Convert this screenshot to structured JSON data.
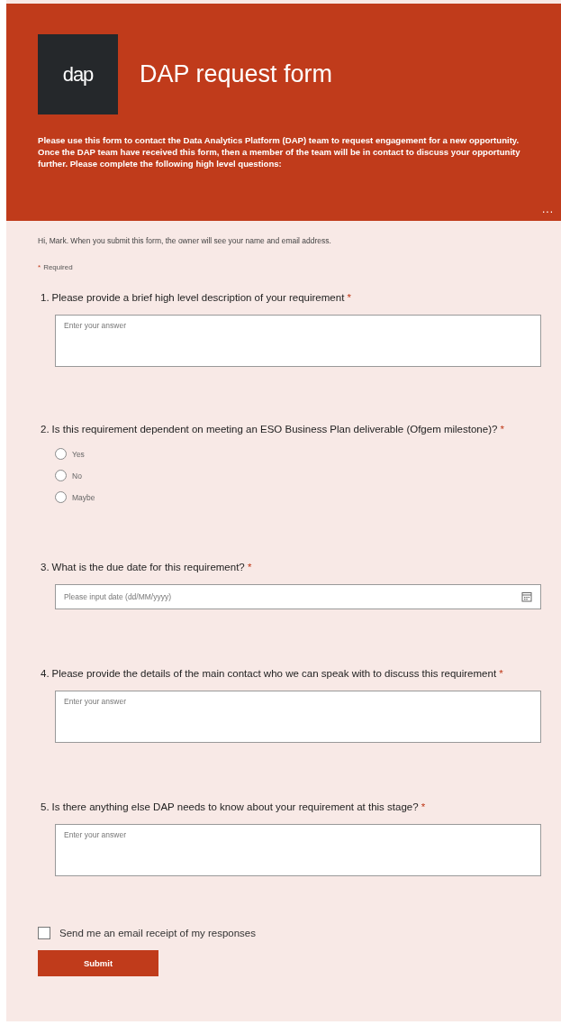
{
  "header": {
    "logo_text": "dap",
    "title": "DAP request form",
    "description": "Please use this form to contact the Data Analytics Platform (DAP) team to request engagement for a new opportunity. Once the DAP team have received this form, then a member of the team will be in contact to discuss your opportunity further. Please complete the following high level questions:",
    "more": "..."
  },
  "notice": "Hi, Mark. When you submit this form, the owner will see your name and email address.",
  "required_legend": {
    "mark": "*",
    "label": "Required"
  },
  "questions": [
    {
      "kind": "text",
      "number": "1.",
      "text": "Please provide a brief high level description of your requirement",
      "mark": "*",
      "placeholder": "Enter your answer"
    },
    {
      "kind": "choice",
      "number": "2.",
      "text": "Is this requirement dependent on meeting an ESO Business Plan deliverable (Ofgem milestone)?",
      "mark": "*",
      "options": [
        {
          "label": "Yes",
          "selected": false
        },
        {
          "label": "No",
          "selected": false
        },
        {
          "label": "Maybe",
          "selected": false
        }
      ]
    },
    {
      "kind": "date",
      "number": "3.",
      "text": "What is the due date for this requirement?",
      "mark": "*",
      "placeholder": "Please input date (dd/MM/yyyy)"
    },
    {
      "kind": "text",
      "number": "4.",
      "text": "Please provide the details of the main contact who we can speak with to discuss this requirement",
      "mark": "*",
      "placeholder": "Enter your answer"
    },
    {
      "kind": "text",
      "number": "5.",
      "text": "Is there anything else DAP needs to know about your requirement at this stage?",
      "mark": "*",
      "placeholder": "Enter your answer"
    }
  ],
  "receipt": {
    "label": "Send me an email receipt of my responses",
    "checked": false
  },
  "submit": "Submit"
}
